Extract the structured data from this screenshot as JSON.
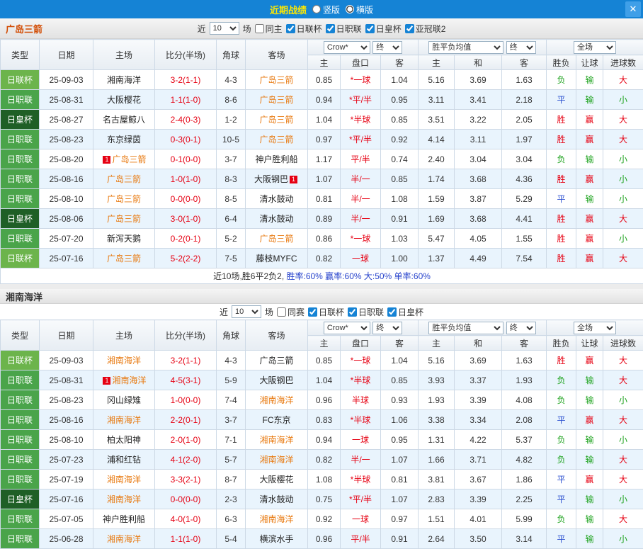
{
  "topbar": {
    "title": "近期战绩",
    "layout_options": [
      {
        "label": "竖版",
        "selected": false
      },
      {
        "label": "横版",
        "selected": true
      }
    ],
    "close_icon": "✕"
  },
  "type_colors": {
    "日联杯": "#6cb44c",
    "日职联": "#4aa44a",
    "日皇杯": "#1f5f26"
  },
  "result_colors": {
    "胜": "#e60012",
    "平": "#2b50d0",
    "负": "#1ca21c",
    "赢": "#e60012",
    "输": "#1ca21c",
    "大": "#e60012",
    "小": "#1ca21c"
  },
  "sections": [
    {
      "team": "广岛三箭",
      "team_color": "#d24a00",
      "stacked": false,
      "filters": {
        "prefix": "近",
        "count": "10",
        "suffix": "场",
        "options": [
          {
            "label": "同主",
            "checked": false
          },
          {
            "label": "日联杯",
            "checked": true
          },
          {
            "label": "日职联",
            "checked": true
          },
          {
            "label": "日皇杯",
            "checked": true
          },
          {
            "label": "亚冠联2",
            "checked": true
          }
        ]
      },
      "header": {
        "cols": [
          "类型",
          "日期",
          "主场",
          "比分(半场)",
          "角球",
          "客场"
        ],
        "selects": [
          "Crow*",
          "终",
          "胜平负均值",
          "终",
          "全场"
        ],
        "subs": [
          "主",
          "盘口",
          "客",
          "主",
          "和",
          "客",
          "胜负",
          "让球",
          "进球数"
        ]
      },
      "rows": [
        {
          "type": "日联杯",
          "date": "25-09-03",
          "home": "湘南海洋",
          "home_focus": false,
          "home_card": "",
          "score": "3-2(1-1)",
          "corner": "4-3",
          "away": "广岛三箭",
          "away_focus": true,
          "away_card": "",
          "odds": [
            "0.85",
            "*一球",
            "1.04"
          ],
          "europe": [
            "5.16",
            "3.69",
            "1.63"
          ],
          "outcome": [
            "负",
            "输",
            "大"
          ]
        },
        {
          "type": "日职联",
          "date": "25-08-31",
          "home": "大阪樱花",
          "home_focus": false,
          "home_card": "",
          "score": "1-1(1-0)",
          "corner": "8-6",
          "away": "广岛三箭",
          "away_focus": true,
          "away_card": "",
          "odds": [
            "0.94",
            "*平/半",
            "0.95"
          ],
          "europe": [
            "3.11",
            "3.41",
            "2.18"
          ],
          "outcome": [
            "平",
            "输",
            "小"
          ]
        },
        {
          "type": "日皇杯",
          "date": "25-08-27",
          "home": "名古屋鲸八",
          "home_focus": false,
          "home_card": "",
          "score": "2-4(0-3)",
          "corner": "1-2",
          "away": "广岛三箭",
          "away_focus": true,
          "away_card": "",
          "odds": [
            "1.04",
            "*半球",
            "0.85"
          ],
          "europe": [
            "3.51",
            "3.22",
            "2.05"
          ],
          "outcome": [
            "胜",
            "赢",
            "大"
          ]
        },
        {
          "type": "日职联",
          "date": "25-08-23",
          "home": "东京绿茵",
          "home_focus": false,
          "home_card": "",
          "score": "0-3(0-1)",
          "corner": "10-5",
          "away": "广岛三箭",
          "away_focus": true,
          "away_card": "",
          "odds": [
            "0.97",
            "*平/半",
            "0.92"
          ],
          "europe": [
            "4.14",
            "3.11",
            "1.97"
          ],
          "outcome": [
            "胜",
            "赢",
            "大"
          ]
        },
        {
          "type": "日职联",
          "date": "25-08-20",
          "home": "广岛三箭",
          "home_focus": true,
          "home_card": "1",
          "score": "0-1(0-0)",
          "corner": "3-7",
          "away": "神户胜利船",
          "away_focus": false,
          "away_card": "",
          "odds": [
            "1.17",
            "平/半",
            "0.74"
          ],
          "europe": [
            "2.40",
            "3.04",
            "3.04"
          ],
          "outcome": [
            "负",
            "输",
            "小"
          ]
        },
        {
          "type": "日职联",
          "date": "25-08-16",
          "home": "广岛三箭",
          "home_focus": true,
          "home_card": "",
          "score": "1-0(1-0)",
          "corner": "8-3",
          "away": "大阪钢巴",
          "away_focus": false,
          "away_card": "1",
          "odds": [
            "1.07",
            "半/一",
            "0.85"
          ],
          "europe": [
            "1.74",
            "3.68",
            "4.36"
          ],
          "outcome": [
            "胜",
            "赢",
            "小"
          ]
        },
        {
          "type": "日职联",
          "date": "25-08-10",
          "home": "广岛三箭",
          "home_focus": true,
          "home_card": "",
          "score": "0-0(0-0)",
          "corner": "8-5",
          "away": "清水鼓动",
          "away_focus": false,
          "away_card": "",
          "odds": [
            "0.81",
            "半/一",
            "1.08"
          ],
          "europe": [
            "1.59",
            "3.87",
            "5.29"
          ],
          "outcome": [
            "平",
            "输",
            "小"
          ]
        },
        {
          "type": "日皇杯",
          "date": "25-08-06",
          "home": "广岛三箭",
          "home_focus": true,
          "home_card": "",
          "score": "3-0(1-0)",
          "corner": "6-4",
          "away": "清水鼓动",
          "away_focus": false,
          "away_card": "",
          "odds": [
            "0.89",
            "半/一",
            "0.91"
          ],
          "europe": [
            "1.69",
            "3.68",
            "4.41"
          ],
          "outcome": [
            "胜",
            "赢",
            "大"
          ]
        },
        {
          "type": "日职联",
          "date": "25-07-20",
          "home": "新泻天鹅",
          "home_focus": false,
          "home_card": "",
          "score": "0-2(0-1)",
          "corner": "5-2",
          "away": "广岛三箭",
          "away_focus": true,
          "away_card": "",
          "odds": [
            "0.86",
            "*一球",
            "1.03"
          ],
          "europe": [
            "5.47",
            "4.05",
            "1.55"
          ],
          "outcome": [
            "胜",
            "赢",
            "小"
          ]
        },
        {
          "type": "日联杯",
          "date": "25-07-16",
          "home": "广岛三箭",
          "home_focus": true,
          "home_card": "",
          "score": "5-2(2-2)",
          "corner": "7-5",
          "away": "藤枝MYFC",
          "away_focus": false,
          "away_card": "",
          "odds": [
            "0.82",
            "一球",
            "1.00"
          ],
          "europe": [
            "1.37",
            "4.49",
            "7.54"
          ],
          "outcome": [
            "胜",
            "赢",
            "大"
          ]
        }
      ],
      "summary": {
        "record": "近10场,胜6平2负2,",
        "stats": "胜率:60% 赢率:60% 大:50% 单率:60%"
      }
    },
    {
      "team": "湘南海洋",
      "team_color": "#333333",
      "stacked": true,
      "filters": {
        "prefix": "近",
        "count": "10",
        "suffix": "场",
        "options": [
          {
            "label": "同赛",
            "checked": false
          },
          {
            "label": "日联杯",
            "checked": true
          },
          {
            "label": "日职联",
            "checked": true
          },
          {
            "label": "日皇杯",
            "checked": true
          }
        ]
      },
      "header": {
        "cols": [
          "类型",
          "日期",
          "主场",
          "比分(半场)",
          "角球",
          "客场"
        ],
        "selects": [
          "Crow*",
          "终",
          "胜平负均值",
          "终",
          "全场"
        ],
        "subs": [
          "主",
          "盘口",
          "客",
          "主",
          "和",
          "客",
          "胜负",
          "让球",
          "进球数"
        ]
      },
      "rows": [
        {
          "type": "日联杯",
          "date": "25-09-03",
          "home": "湘南海洋",
          "home_focus": true,
          "home_card": "",
          "score": "3-2(1-1)",
          "corner": "4-3",
          "away": "广岛三箭",
          "away_focus": false,
          "away_card": "",
          "odds": [
            "0.85",
            "*一球",
            "1.04"
          ],
          "europe": [
            "5.16",
            "3.69",
            "1.63"
          ],
          "outcome": [
            "胜",
            "赢",
            "大"
          ]
        },
        {
          "type": "日职联",
          "date": "25-08-31",
          "home": "湘南海洋",
          "home_focus": true,
          "home_card": "1",
          "score": "4-5(3-1)",
          "corner": "5-9",
          "away": "大阪钢巴",
          "away_focus": false,
          "away_card": "",
          "odds": [
            "1.04",
            "*半球",
            "0.85"
          ],
          "europe": [
            "3.93",
            "3.37",
            "1.93"
          ],
          "outcome": [
            "负",
            "输",
            "大"
          ]
        },
        {
          "type": "日职联",
          "date": "25-08-23",
          "home": "冈山绿雉",
          "home_focus": false,
          "home_card": "",
          "score": "1-0(0-0)",
          "corner": "7-4",
          "away": "湘南海洋",
          "away_focus": true,
          "away_card": "",
          "odds": [
            "0.96",
            "半球",
            "0.93"
          ],
          "europe": [
            "1.93",
            "3.39",
            "4.08"
          ],
          "outcome": [
            "负",
            "输",
            "小"
          ]
        },
        {
          "type": "日职联",
          "date": "25-08-16",
          "home": "湘南海洋",
          "home_focus": true,
          "home_card": "",
          "score": "2-2(0-1)",
          "corner": "3-7",
          "away": "FC东京",
          "away_focus": false,
          "away_card": "",
          "odds": [
            "0.83",
            "*半球",
            "1.06"
          ],
          "europe": [
            "3.38",
            "3.34",
            "2.08"
          ],
          "outcome": [
            "平",
            "赢",
            "大"
          ]
        },
        {
          "type": "日职联",
          "date": "25-08-10",
          "home": "柏太阳神",
          "home_focus": false,
          "home_card": "",
          "score": "2-0(1-0)",
          "corner": "7-1",
          "away": "湘南海洋",
          "away_focus": true,
          "away_card": "",
          "odds": [
            "0.94",
            "一球",
            "0.95"
          ],
          "europe": [
            "1.31",
            "4.22",
            "5.37"
          ],
          "outcome": [
            "负",
            "输",
            "小"
          ]
        },
        {
          "type": "日职联",
          "date": "25-07-23",
          "home": "浦和红钻",
          "home_focus": false,
          "home_card": "",
          "score": "4-1(2-0)",
          "corner": "5-7",
          "away": "湘南海洋",
          "away_focus": true,
          "away_card": "",
          "odds": [
            "0.82",
            "半/一",
            "1.07"
          ],
          "europe": [
            "1.66",
            "3.71",
            "4.82"
          ],
          "outcome": [
            "负",
            "输",
            "大"
          ]
        },
        {
          "type": "日职联",
          "date": "25-07-19",
          "home": "湘南海洋",
          "home_focus": true,
          "home_card": "",
          "score": "3-3(2-1)",
          "corner": "8-7",
          "away": "大阪樱花",
          "away_focus": false,
          "away_card": "",
          "odds": [
            "1.08",
            "*半球",
            "0.81"
          ],
          "europe": [
            "3.81",
            "3.67",
            "1.86"
          ],
          "outcome": [
            "平",
            "赢",
            "大"
          ]
        },
        {
          "type": "日皇杯",
          "date": "25-07-16",
          "home": "湘南海洋",
          "home_focus": true,
          "home_card": "",
          "score": "0-0(0-0)",
          "corner": "2-3",
          "away": "清水鼓动",
          "away_focus": false,
          "away_card": "",
          "odds": [
            "0.75",
            "*平/半",
            "1.07"
          ],
          "europe": [
            "2.83",
            "3.39",
            "2.25"
          ],
          "outcome": [
            "平",
            "输",
            "小"
          ]
        },
        {
          "type": "日职联",
          "date": "25-07-05",
          "home": "神户胜利船",
          "home_focus": false,
          "home_card": "",
          "score": "4-0(1-0)",
          "corner": "6-3",
          "away": "湘南海洋",
          "away_focus": true,
          "away_card": "",
          "odds": [
            "0.92",
            "一球",
            "0.97"
          ],
          "europe": [
            "1.51",
            "4.01",
            "5.99"
          ],
          "outcome": [
            "负",
            "输",
            "大"
          ]
        },
        {
          "type": "日职联",
          "date": "25-06-28",
          "home": "湘南海洋",
          "home_focus": true,
          "home_card": "",
          "score": "1-1(1-0)",
          "corner": "5-4",
          "away": "横滨水手",
          "away_focus": false,
          "away_card": "",
          "odds": [
            "0.96",
            "平/半",
            "0.91"
          ],
          "europe": [
            "2.64",
            "3.50",
            "3.14"
          ],
          "outcome": [
            "平",
            "输",
            "小"
          ]
        }
      ]
    }
  ]
}
